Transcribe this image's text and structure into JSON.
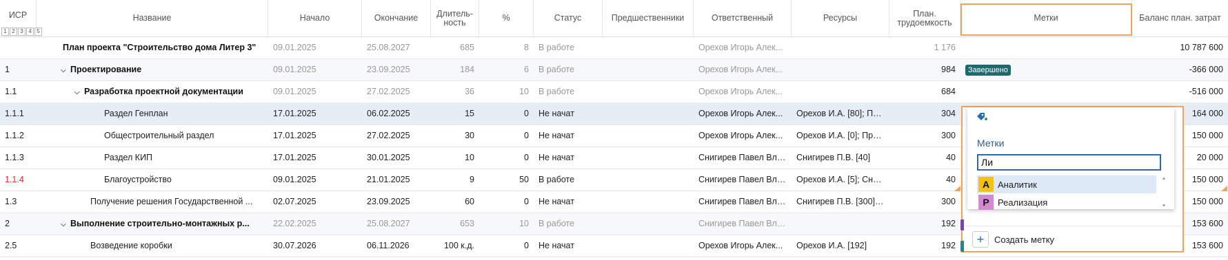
{
  "columns": {
    "isr": "ИСР",
    "name": "Название",
    "start": "Начало",
    "end": "Окончание",
    "duration": "Длитель-ность",
    "percent": "%",
    "status": "Статус",
    "predecessors": "Предшественники",
    "responsible": "Ответственный",
    "resources": "Ресурсы",
    "plan_labor": "План. трудоемкость",
    "tags": "Метки",
    "balance": "Баланс план. затрат"
  },
  "levels": [
    "1",
    "2",
    "3",
    "4",
    "5"
  ],
  "rows": [
    {
      "isr": "",
      "name": "План проекта \"Строительство дома Литер 3\"",
      "start": "09.01.2025",
      "end": "25.08.2027",
      "duration": "685",
      "percent": "8",
      "status": "В работе",
      "predecessors": "",
      "responsible": "Орехов Игорь Алек...",
      "resources": "",
      "plan_labor": "1 176",
      "tag": "",
      "balance": "10 787 600"
    },
    {
      "isr": "1",
      "name": "Проектирование",
      "start": "09.01.2025",
      "end": "23.09.2025",
      "duration": "184",
      "percent": "6",
      "status": "В работе",
      "predecessors": "",
      "responsible": "Орехов Игорь Алек...",
      "resources": "",
      "plan_labor": "984",
      "tag": "Завершено",
      "balance": "-366 000"
    },
    {
      "isr": "1.1",
      "name": "Разработка проектной документации",
      "start": "09.01.2025",
      "end": "27.02.2025",
      "duration": "36",
      "percent": "10",
      "status": "В работе",
      "predecessors": "",
      "responsible": "Орехов Игорь Алек...",
      "resources": "",
      "plan_labor": "684",
      "tag": "",
      "balance": "-516 000"
    },
    {
      "isr": "1.1.1",
      "name": "Раздел Генплан",
      "start": "17.01.2025",
      "end": "06.02.2025",
      "duration": "15",
      "percent": "0",
      "status": "Не начат",
      "predecessors": "",
      "responsible": "Орехов Игорь Алек...",
      "resources": "Орехов И.А. [80]; Пр...",
      "plan_labor": "304",
      "tag": "",
      "balance": "164 000"
    },
    {
      "isr": "1.1.2",
      "name": "Общестроительный раздел",
      "start": "17.01.2025",
      "end": "27.02.2025",
      "duration": "30",
      "percent": "0",
      "status": "Не начат",
      "predecessors": "",
      "responsible": "Орехов Игорь Алек...",
      "resources": "Орехов И.А. [0]; Про...",
      "plan_labor": "300",
      "tag": "",
      "balance": "150 000"
    },
    {
      "isr": "1.1.3",
      "name": "Раздел КИП",
      "start": "17.01.2025",
      "end": "30.01.2025",
      "duration": "10",
      "percent": "0",
      "status": "Не начат",
      "predecessors": "",
      "responsible": "Снигирев Павел Вла...",
      "resources": "Снигирев П.В. [40]",
      "plan_labor": "40",
      "tag": "",
      "balance": "20 000"
    },
    {
      "isr": "1.1.4",
      "name": "Благоустройство",
      "start": "09.01.2025",
      "end": "21.01.2025",
      "duration": "9",
      "percent": "50",
      "status": "В работе",
      "predecessors": "",
      "responsible": "Снигирев Павел Вла...",
      "resources": "Орехов И.А. [5]; Сни...",
      "plan_labor": "40",
      "tag": "",
      "balance": "150 000"
    },
    {
      "isr": "1.3",
      "name": "Получение решения Государственной ...",
      "start": "02.07.2025",
      "end": "23.09.2025",
      "duration": "60",
      "percent": "0",
      "status": "Не начат",
      "predecessors": "",
      "responsible": "Снигирев Павел Вла...",
      "resources": "Снигирев П.В. [300]; ...",
      "plan_labor": "300",
      "tag": "",
      "balance": "150 000"
    },
    {
      "isr": "2",
      "name": "Выполнение строительно-монтажных р...",
      "start": "22.02.2025",
      "end": "25.08.2027",
      "duration": "653",
      "percent": "10",
      "status": "В работе",
      "predecessors": "",
      "responsible": "Снигирев Павел Вла...",
      "resources": "",
      "plan_labor": "192",
      "tag": "",
      "balance": "153 600"
    },
    {
      "isr": "2.5",
      "name": "Возведение коробки",
      "start": "30.07.2026",
      "end": "06.11.2026",
      "duration": "100 к.д.",
      "percent": "0",
      "status": "Не начат",
      "predecessors": "",
      "responsible": "Орехов Игорь Алек...",
      "resources": "Орехов И.А. [192]",
      "plan_labor": "192",
      "tag": "",
      "balance": "153 600"
    }
  ],
  "popup": {
    "label": "Метки",
    "input_value": "Ли",
    "options": [
      {
        "letter": "А",
        "text": "Аналитик",
        "color": "#f2c21b"
      },
      {
        "letter": "Р",
        "text": "Реализация",
        "color": "#d48ad2"
      }
    ],
    "create_label": "Создать метку",
    "create_icon": "plus-icon"
  },
  "colors": {
    "tag_done": "#1b6b6e",
    "highlight_border": "#f0a262",
    "selected_row": "#e6edf5",
    "critical_isr": "#e0302c"
  }
}
